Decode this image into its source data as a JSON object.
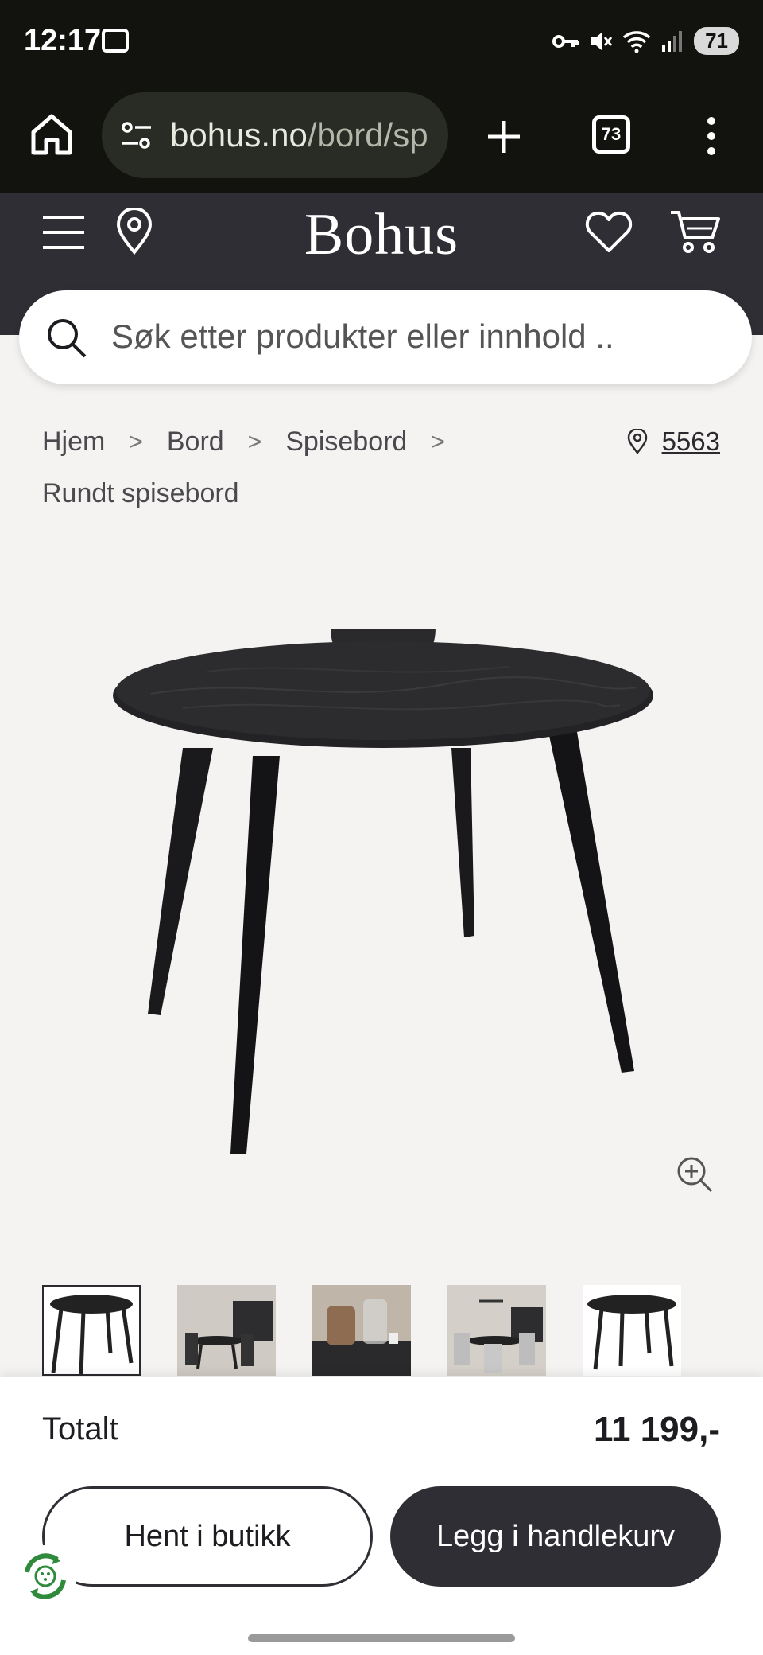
{
  "status": {
    "time": "12:17",
    "battery": "71"
  },
  "browser": {
    "url_main": "bohus.no",
    "url_path": "/bord/sp",
    "tab_count": "73"
  },
  "header": {
    "logo": "Bohus"
  },
  "search": {
    "placeholder": "Søk etter produkter eller innhold .."
  },
  "breadcrumb": {
    "items": [
      "Hjem",
      "Bord",
      "Spisebord",
      "Rundt spisebord"
    ],
    "store_number": "5563"
  },
  "product": {
    "image_name": "round-black-dining-table"
  },
  "thumbnails": {
    "count": 5,
    "active_index": 0
  },
  "cart_panel": {
    "total_label": "Totalt",
    "total_price": "11 199,-",
    "pickup_label": "Hent i butikk",
    "add_to_cart_label": "Legg i handlekurv"
  },
  "colors": {
    "header": "#2e2e34",
    "browser": "#12130f",
    "page": "#f4f3f1",
    "accent_eco": "#2f8a3c"
  }
}
